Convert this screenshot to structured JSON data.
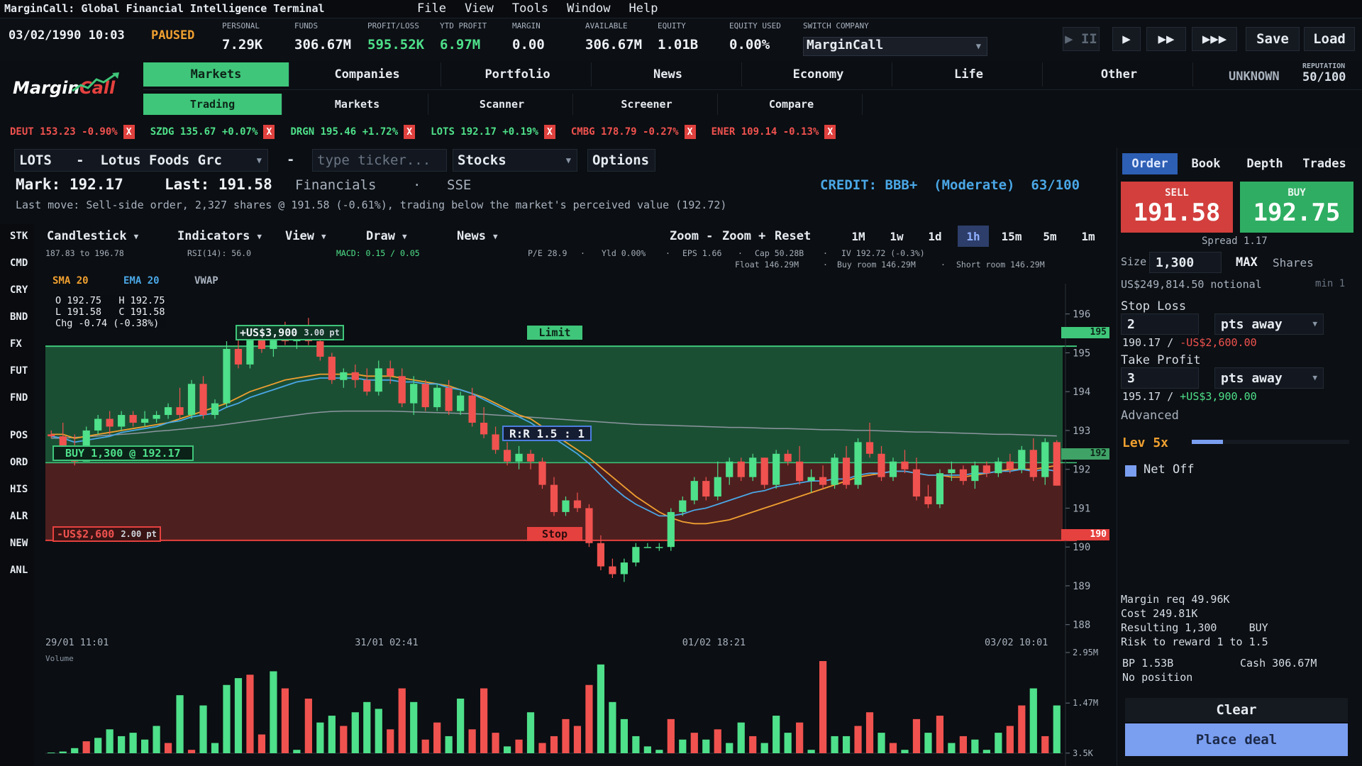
{
  "app": {
    "title": "MarginCall: Global Financial Intelligence Terminal",
    "menu": [
      "File",
      "View",
      "Tools",
      "Window",
      "Help"
    ],
    "logo_text": "MarginCall"
  },
  "status": {
    "datetime": "03/02/1990 10:03",
    "state": "PAUSED",
    "stats": [
      {
        "label": "PERSONAL",
        "value": "7.29K",
        "color": "#eef2f6"
      },
      {
        "label": "FUNDS",
        "value": "306.67M",
        "color": "#eef2f6"
      },
      {
        "label": "PROFIT/LOSS",
        "value": "595.52K",
        "color": "#4ee08a"
      },
      {
        "label": "YTD PROFIT",
        "value": "6.97M",
        "color": "#4ee08a"
      },
      {
        "label": "MARGIN",
        "value": "0.00",
        "color": "#eef2f6"
      },
      {
        "label": "AVAILABLE",
        "value": "306.67M",
        "color": "#eef2f6"
      },
      {
        "label": "EQUITY",
        "value": "1.01B",
        "color": "#eef2f6"
      },
      {
        "label": "EQUITY USED",
        "value": "0.00%",
        "color": "#eef2f6"
      }
    ],
    "switch_company_label": "SWITCH COMPANY",
    "company": "MarginCall",
    "speed": {
      "pause": "▶ II",
      "play": "▶",
      "fast": "▶▶",
      "fastest": "▶▶▶"
    },
    "save": "Save",
    "load": "Load"
  },
  "main_tabs": [
    "Markets",
    "Companies",
    "Portfolio",
    "News",
    "Economy",
    "Life",
    "Other"
  ],
  "sub_tabs": [
    "Trading",
    "Markets",
    "Scanner",
    "Screener",
    "Compare"
  ],
  "rank": "UNKNOWN",
  "reputation": {
    "label": "REPUTATION",
    "value": "50/100"
  },
  "tickers": [
    {
      "text": "DEUT 153.23 -0.90%",
      "color": "#f0524f"
    },
    {
      "text": "SZDG 135.67 +0.07%",
      "color": "#4ee08a"
    },
    {
      "text": "DRGN 195.46 +1.72%",
      "color": "#4ee08a"
    },
    {
      "text": "LOTS 192.17 +0.19%",
      "color": "#4ee08a"
    },
    {
      "text": "CMBG 178.79 -0.27%",
      "color": "#f0524f"
    },
    {
      "text": "ENER 109.14 -0.13%",
      "color": "#f0524f"
    }
  ],
  "instrument": {
    "symbol_field": "LOTS   -  Lotus Foods Grc",
    "dash": "-",
    "ticker_placeholder": "type ticker...",
    "asset_class": "Stocks",
    "options": "Options",
    "mark": "Mark: 192.17",
    "last": "Last: 191.58",
    "sector": "Financials",
    "dot": "·",
    "exchange": "SSE",
    "credit": "CREDIT: BBB+  (Moderate)  63/100",
    "last_move": "Last move: Sell-side order, 2,327 shares @ 191.58 (-0.61%), trading below the market's perceived value (192.72)"
  },
  "rail": [
    "STK",
    "CMD",
    "CRY",
    "BND",
    "FX",
    "FUT",
    "FND",
    "POS",
    "ORD",
    "HIS",
    "ALR",
    "NEW",
    "ANL"
  ],
  "chart_toolbar": {
    "type": "Candlestick",
    "indicators": "Indicators",
    "view": "View",
    "draw": "Draw",
    "news": "News",
    "zoom_out": "Zoom -",
    "zoom_in": "Zoom +",
    "reset": "Reset",
    "timeframes": [
      "1M",
      "1w",
      "1d",
      "1h",
      "15m",
      "5m",
      "1m"
    ],
    "active_timeframe": "1h",
    "range": "187.83 to 196.78",
    "rsi": "RSI(14): 56.0",
    "macd": "MACD: 0.15 / 0.05",
    "pe": "P/E 28.9",
    "yld": "Yld 0.00%",
    "eps": "EPS 1.66",
    "cap": "Cap 50.28B",
    "iv": "IV 192.72 (-0.3%)",
    "float": "Float 146.29M",
    "buy_room": "Buy room 146.29M",
    "short_room": "Short room 146.29M",
    "sep": "·"
  },
  "legend": {
    "sma": "SMA 20",
    "ema": "EMA 20",
    "vwap": "VWAP"
  },
  "ohlc": {
    "o": "O 192.75",
    "h": "H 192.75",
    "l": "L 191.58",
    "c": "C 191.58",
    "chg": "Chg -0.74 (-0.38%)"
  },
  "overlays": {
    "limit_label": "Limit",
    "stop_label": "Stop",
    "profit_tag": "+US$3,900",
    "profit_pts": "3.00 pt",
    "loss_tag": "-US$2,600",
    "loss_pts": "2.00 pt",
    "entry_tag": "BUY 1,300 @ 192.17",
    "rr": "R:R 1.5 : 1",
    "limit_price_tag": "195",
    "entry_price_tag": "192",
    "stop_price_tag": "190"
  },
  "chart_data": {
    "type": "candlestick",
    "symbol": "LOTS",
    "ylim": [
      187.83,
      196.78
    ],
    "yticks": [
      196,
      195,
      194,
      193,
      192,
      191,
      190,
      189,
      188
    ],
    "xticks": [
      "29/01 11:01",
      "31/01 02:41",
      "01/02 18:21",
      "03/02 10:01"
    ],
    "limit": 195.17,
    "entry": 192.17,
    "stop": 190.17,
    "candles": [
      [
        192.9,
        193.0,
        192.8,
        192.85
      ],
      [
        192.85,
        193.2,
        192.5,
        192.6
      ],
      [
        192.6,
        192.9,
        192.1,
        192.2
      ],
      [
        192.2,
        193.1,
        192.2,
        193.0
      ],
      [
        193.0,
        193.4,
        192.9,
        193.3
      ],
      [
        193.3,
        193.5,
        192.9,
        193.1
      ],
      [
        193.1,
        193.5,
        193.0,
        193.4
      ],
      [
        193.4,
        193.5,
        193.1,
        193.2
      ],
      [
        193.2,
        193.5,
        193.1,
        193.3
      ],
      [
        193.3,
        193.5,
        193.2,
        193.4
      ],
      [
        193.4,
        193.7,
        193.3,
        193.6
      ],
      [
        193.6,
        194.1,
        193.3,
        193.4
      ],
      [
        193.4,
        194.3,
        193.3,
        194.2
      ],
      [
        194.2,
        194.4,
        193.3,
        193.4
      ],
      [
        193.4,
        193.8,
        193.3,
        193.7
      ],
      [
        193.7,
        195.3,
        193.6,
        195.1
      ],
      [
        195.1,
        195.5,
        194.6,
        194.7
      ],
      [
        194.7,
        195.5,
        194.6,
        195.4
      ],
      [
        195.4,
        195.7,
        195.0,
        195.1
      ],
      [
        195.1,
        195.6,
        194.9,
        195.5
      ],
      [
        195.5,
        195.8,
        195.2,
        195.3
      ],
      [
        195.3,
        195.7,
        195.1,
        195.6
      ],
      [
        195.6,
        195.9,
        195.2,
        195.3
      ],
      [
        195.3,
        195.4,
        194.8,
        194.9
      ],
      [
        194.9,
        195.0,
        194.2,
        194.3
      ],
      [
        194.3,
        194.6,
        194.1,
        194.5
      ],
      [
        194.5,
        194.7,
        194.1,
        194.3
      ],
      [
        194.3,
        194.6,
        193.9,
        194.0
      ],
      [
        194.0,
        194.8,
        193.9,
        194.6
      ],
      [
        194.6,
        194.8,
        194.2,
        194.4
      ],
      [
        194.4,
        194.6,
        193.6,
        193.7
      ],
      [
        193.7,
        194.4,
        193.4,
        194.2
      ],
      [
        194.2,
        194.3,
        193.5,
        193.6
      ],
      [
        193.6,
        194.2,
        193.5,
        194.1
      ],
      [
        194.1,
        194.3,
        193.4,
        193.5
      ],
      [
        193.5,
        194.0,
        193.4,
        193.9
      ],
      [
        193.9,
        194.1,
        193.1,
        193.2
      ],
      [
        193.2,
        193.6,
        192.8,
        192.9
      ],
      [
        192.9,
        193.1,
        192.4,
        192.5
      ],
      [
        192.5,
        192.7,
        192.1,
        192.2
      ],
      [
        192.2,
        192.6,
        192.0,
        192.4
      ],
      [
        192.4,
        192.5,
        192.0,
        192.2
      ],
      [
        192.2,
        192.3,
        191.5,
        191.6
      ],
      [
        191.6,
        191.8,
        190.8,
        190.9
      ],
      [
        190.9,
        191.3,
        190.8,
        191.2
      ],
      [
        191.2,
        191.4,
        190.9,
        191.0
      ],
      [
        191.0,
        191.1,
        190.0,
        190.1
      ],
      [
        190.1,
        190.3,
        189.4,
        189.5
      ],
      [
        189.5,
        189.7,
        189.2,
        189.3
      ],
      [
        189.3,
        189.7,
        189.1,
        189.6
      ],
      [
        189.6,
        190.1,
        189.5,
        190.0
      ],
      [
        190.0,
        190.1,
        190.0,
        190.0
      ],
      [
        190.0,
        190.1,
        189.9,
        190.0
      ],
      [
        190.0,
        191.0,
        189.9,
        190.9
      ],
      [
        190.9,
        191.3,
        190.8,
        191.2
      ],
      [
        191.2,
        191.8,
        191.1,
        191.7
      ],
      [
        191.7,
        191.8,
        191.2,
        191.3
      ],
      [
        191.3,
        192.2,
        191.2,
        191.8
      ],
      [
        191.8,
        192.3,
        191.6,
        192.2
      ],
      [
        192.2,
        192.3,
        191.7,
        191.8
      ],
      [
        191.8,
        192.4,
        191.7,
        192.3
      ],
      [
        192.3,
        192.3,
        191.5,
        191.6
      ],
      [
        191.6,
        192.5,
        191.5,
        192.4
      ],
      [
        192.4,
        192.5,
        192.1,
        192.2
      ],
      [
        192.2,
        192.6,
        191.6,
        191.7
      ],
      [
        191.7,
        192.0,
        191.4,
        191.8
      ],
      [
        191.8,
        192.1,
        191.5,
        191.6
      ],
      [
        191.6,
        192.4,
        191.5,
        192.3
      ],
      [
        192.3,
        192.6,
        191.5,
        191.6
      ],
      [
        191.6,
        192.8,
        191.5,
        192.7
      ],
      [
        192.7,
        193.2,
        192.3,
        192.4
      ],
      [
        192.4,
        192.6,
        191.7,
        191.8
      ],
      [
        191.8,
        192.3,
        191.7,
        192.2
      ],
      [
        192.2,
        192.5,
        191.9,
        192.0
      ],
      [
        192.0,
        192.3,
        191.2,
        191.3
      ],
      [
        191.3,
        191.6,
        191.0,
        191.1
      ],
      [
        191.1,
        192.0,
        191.0,
        191.9
      ],
      [
        191.9,
        192.2,
        191.7,
        192.0
      ],
      [
        192.0,
        192.1,
        191.6,
        191.7
      ],
      [
        191.7,
        192.2,
        191.5,
        192.1
      ],
      [
        192.1,
        192.2,
        191.8,
        191.9
      ],
      [
        191.9,
        192.3,
        191.8,
        192.2
      ],
      [
        192.2,
        192.4,
        191.9,
        192.0
      ],
      [
        192.0,
        192.6,
        191.9,
        192.5
      ],
      [
        192.5,
        192.8,
        191.7,
        191.8
      ],
      [
        191.8,
        192.8,
        191.6,
        192.7
      ],
      [
        192.7,
        192.75,
        191.58,
        191.58
      ]
    ],
    "sma": [
      192.9,
      192.9,
      192.8,
      192.85,
      192.9,
      192.95,
      193.0,
      193.05,
      193.1,
      193.15,
      193.2,
      193.3,
      193.4,
      193.5,
      193.6,
      193.7,
      193.85,
      194.0,
      194.1,
      194.2,
      194.3,
      194.35,
      194.4,
      194.45,
      194.45,
      194.45,
      194.45,
      194.4,
      194.4,
      194.4,
      194.35,
      194.3,
      194.25,
      194.2,
      194.15,
      194.05,
      193.95,
      193.85,
      193.7,
      193.55,
      193.4,
      193.3,
      193.1,
      192.9,
      192.7,
      192.5,
      192.3,
      192.05,
      191.8,
      191.55,
      191.3,
      191.1,
      190.9,
      190.75,
      190.65,
      190.6,
      190.6,
      190.65,
      190.7,
      190.8,
      190.9,
      191.0,
      191.1,
      191.2,
      191.3,
      191.4,
      191.5,
      191.6,
      191.7,
      191.8,
      191.85,
      191.9,
      191.95,
      191.95,
      191.9,
      191.85,
      191.85,
      191.8,
      191.8,
      191.85,
      191.9,
      191.95,
      192.0,
      192.0,
      192.0,
      192.05,
      192.1
    ],
    "ema": [
      192.85,
      192.8,
      192.7,
      192.75,
      192.8,
      192.85,
      192.95,
      193.0,
      193.05,
      193.1,
      193.2,
      193.25,
      193.35,
      193.4,
      193.45,
      193.6,
      193.7,
      193.85,
      193.95,
      194.05,
      194.15,
      194.25,
      194.3,
      194.35,
      194.35,
      194.35,
      194.35,
      194.3,
      194.3,
      194.3,
      194.25,
      194.25,
      194.2,
      194.2,
      194.1,
      194.05,
      193.95,
      193.8,
      193.65,
      193.5,
      193.35,
      193.2,
      193.0,
      192.8,
      192.6,
      192.4,
      192.15,
      191.85,
      191.55,
      191.3,
      191.1,
      190.95,
      190.8,
      190.8,
      190.85,
      190.95,
      191.0,
      191.1,
      191.2,
      191.3,
      191.4,
      191.45,
      191.55,
      191.6,
      191.65,
      191.7,
      191.7,
      191.75,
      191.75,
      191.85,
      191.9,
      191.9,
      191.95,
      191.95,
      191.9,
      191.85,
      191.85,
      191.85,
      191.85,
      191.9,
      191.9,
      191.95,
      191.95,
      192.0,
      191.95,
      192.0,
      191.95
    ],
    "vwap": [
      192.8,
      192.8,
      192.82,
      192.84,
      192.86,
      192.88,
      192.9,
      192.92,
      192.95,
      192.98,
      193.0,
      193.03,
      193.06,
      193.09,
      193.12,
      193.16,
      193.2,
      193.24,
      193.28,
      193.32,
      193.36,
      193.4,
      193.44,
      193.47,
      193.49,
      193.5,
      193.5,
      193.5,
      193.5,
      193.5,
      193.49,
      193.48,
      193.47,
      193.46,
      193.45,
      193.44,
      193.43,
      193.42,
      193.4,
      193.38,
      193.36,
      193.34,
      193.32,
      193.3,
      193.28,
      193.26,
      193.24,
      193.22,
      193.2,
      193.18,
      193.16,
      193.15,
      193.14,
      193.13,
      193.12,
      193.11,
      193.1,
      193.09,
      193.08,
      193.08,
      193.07,
      193.06,
      193.05,
      193.05,
      193.04,
      193.03,
      193.02,
      193.02,
      193.01,
      193.0,
      193.0,
      192.99,
      192.98,
      192.97,
      192.96,
      192.96,
      192.95,
      192.94,
      192.93,
      192.92,
      192.91,
      192.9,
      192.9,
      192.89,
      192.88,
      192.87,
      192.86
    ],
    "volume": [
      0.02,
      0.05,
      0.15,
      0.35,
      0.45,
      0.7,
      0.5,
      0.6,
      0.4,
      0.8,
      0.3,
      1.7,
      0.1,
      1.4,
      0.3,
      2.0,
      2.2,
      2.3,
      0.55,
      2.4,
      1.9,
      0.1,
      1.6,
      0.9,
      1.1,
      0.8,
      1.2,
      1.5,
      1.3,
      0.7,
      1.9,
      1.5,
      0.4,
      0.9,
      0.5,
      1.6,
      0.7,
      1.9,
      0.6,
      0.2,
      0.4,
      1.2,
      0.3,
      0.5,
      1.0,
      0.8,
      2.0,
      2.6,
      1.5,
      1.0,
      0.5,
      0.2,
      0.1,
      1.0,
      0.4,
      0.6,
      0.4,
      0.7,
      0.3,
      0.9,
      0.5,
      0.3,
      1.1,
      0.6,
      0.9,
      0.1,
      2.7,
      0.5,
      0.5,
      0.8,
      1.2,
      0.6,
      0.3,
      0.1,
      1.0,
      0.6,
      1.1,
      0.3,
      0.5,
      0.4,
      0.1,
      0.6,
      0.8,
      1.4,
      1.9,
      0.5,
      1.4
    ],
    "volume_colors": "gggrggggggrgrggggrrgrgrggrgggrrgrrggrrrgrgrrrrrggggggrgrgrggrgggrgrggrrgrgrgrgrgggrrgr",
    "volume_ticks": [
      "2.95M",
      "1.47M",
      "3.5K"
    ],
    "volume_label": "Volume"
  },
  "order_panel": {
    "tabs": [
      "Order",
      "Book",
      "Depth",
      "Trades"
    ],
    "active_tab": "Order",
    "sell_label": "SELL",
    "sell_price": "191.58",
    "buy_label": "BUY",
    "buy_price": "192.75",
    "spread": "Spread 1.17",
    "size_label": "Size",
    "size_value": "1,300",
    "max_label": "MAX",
    "shares_label": "Shares",
    "notional": "US$249,814.50 notional",
    "min_label": "min 1",
    "stop_loss_label": "Stop Loss",
    "stop_value": "2",
    "stop_unit": "pts away",
    "stop_price": "190.17",
    "stop_slash": "/",
    "stop_amount": "-US$2,600.00",
    "take_profit_label": "Take Profit",
    "tp_value": "3",
    "tp_unit": "pts away",
    "tp_price": "195.17",
    "tp_slash": "/",
    "tp_amount": "+US$3,900.00",
    "advanced": "Advanced",
    "leverage": "Lev 5x",
    "leverage_fraction": 0.2,
    "net_off": "Net Off",
    "margin_req": "Margin req 49.96K",
    "cost": "Cost 249.81K",
    "resulting": "Resulting 1,300     BUY",
    "risk_reward": "Risk to reward 1 to 1.5",
    "bp": "BP 1.53B",
    "cash": "Cash 306.67M",
    "position": "No position",
    "clear": "Clear",
    "place": "Place deal"
  }
}
